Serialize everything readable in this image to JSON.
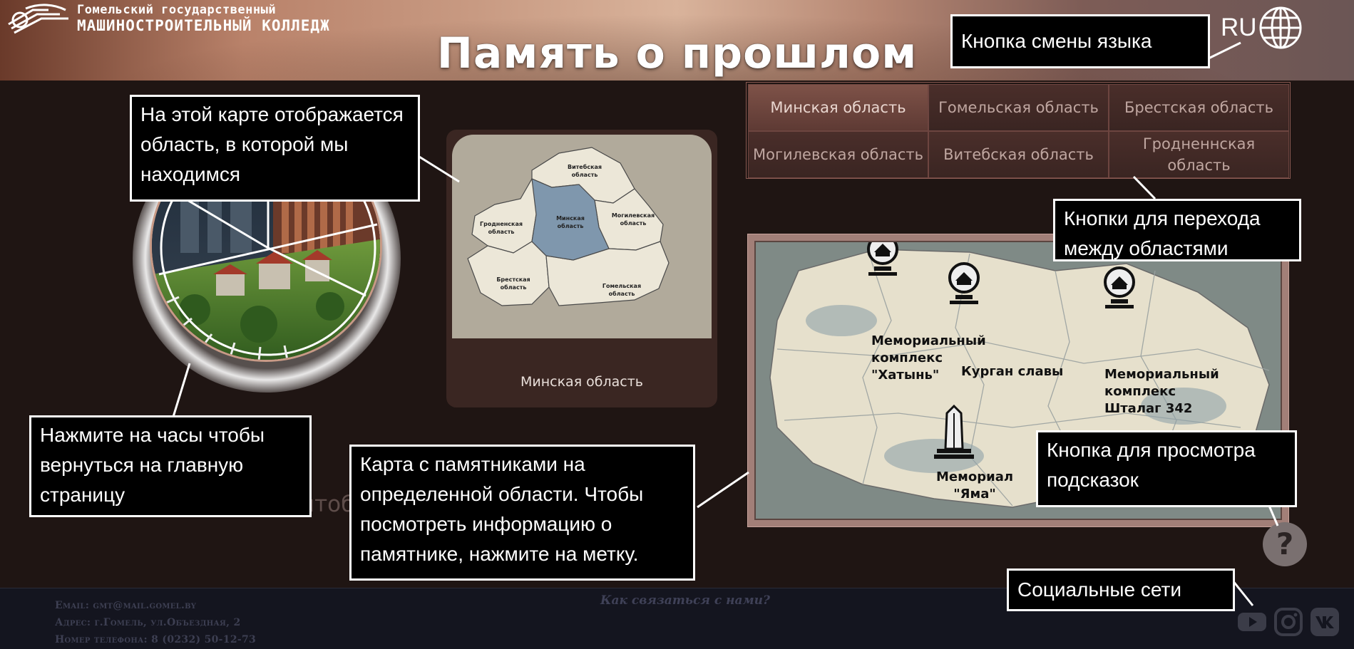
{
  "header": {
    "college_line1": "Гомельский государственный",
    "college_line2": "машиностроительный колледж",
    "title": "Память о прошлом",
    "language": "RU"
  },
  "region_card": {
    "caption": "Минская область",
    "map_labels": {
      "vitebsk": [
        "Витебская",
        "область"
      ],
      "grodno": [
        "Гродненская",
        "область"
      ],
      "minsk": [
        "Минская",
        "область"
      ],
      "mogilev": [
        "Могилевская",
        "область"
      ],
      "brest": [
        "Брестская",
        "область"
      ],
      "gomel": [
        "Гомельская",
        "область"
      ]
    }
  },
  "region_tabs": [
    {
      "label": "Минская область",
      "active": true
    },
    {
      "label": "Гомельская область",
      "active": false
    },
    {
      "label": "Брестская область",
      "active": false
    },
    {
      "label": "Могилевская область",
      "active": false
    },
    {
      "label": "Витебская область",
      "active": false
    },
    {
      "label": "Гродненнская область",
      "active": false
    }
  ],
  "monuments": [
    {
      "name_lines": [
        "Мемориальный",
        "комплекс",
        "\"Хатынь\""
      ],
      "icon": "memorial-icon"
    },
    {
      "name_lines": [
        "Курган славы"
      ],
      "icon": "memorial-icon"
    },
    {
      "name_lines": [
        "Мемориальный",
        "комплекс",
        "Шталаг 342"
      ],
      "icon": "memorial-icon"
    },
    {
      "name_lines": [
        "Мемориал",
        "\"Яма\""
      ],
      "icon": "obelisk-icon"
    }
  ],
  "ghost_text": "Нажмите чтобы вернуться",
  "help_label": "?",
  "callouts": {
    "map_region": "На этой карте отображается область, в которой мы находимся",
    "clock": "Нажмите на часы чтобы вернуться на главную страницу",
    "monument_map": "Карта с памятниками на определенной области. Чтобы посмотреть информацию о памятнике, нажмите на метку.",
    "language": "Кнопка смены языка",
    "tabs": "Кнопки для перехода между областями",
    "help": "Кнопка для просмотра подсказок",
    "social": "Социальные сети"
  },
  "footer": {
    "email": "Email: gmt@mail.gomel.by",
    "address": "Адрес: г.Гомель, ул.Объездная, 2",
    "phone": "Номер телефона: 8 (0232) 50-12-73",
    "contact_title": "Как связаться с нами?",
    "social_icons": [
      "youtube-icon",
      "instagram-icon",
      "vk-icon"
    ]
  },
  "colors": {
    "background": "#1f1513",
    "tab_active": "#7e5248",
    "tab_inactive": "#4a2e2a",
    "minsk_region": "#7f97ad",
    "callout_bg": "#000000",
    "footer_bg": "#14151f"
  }
}
